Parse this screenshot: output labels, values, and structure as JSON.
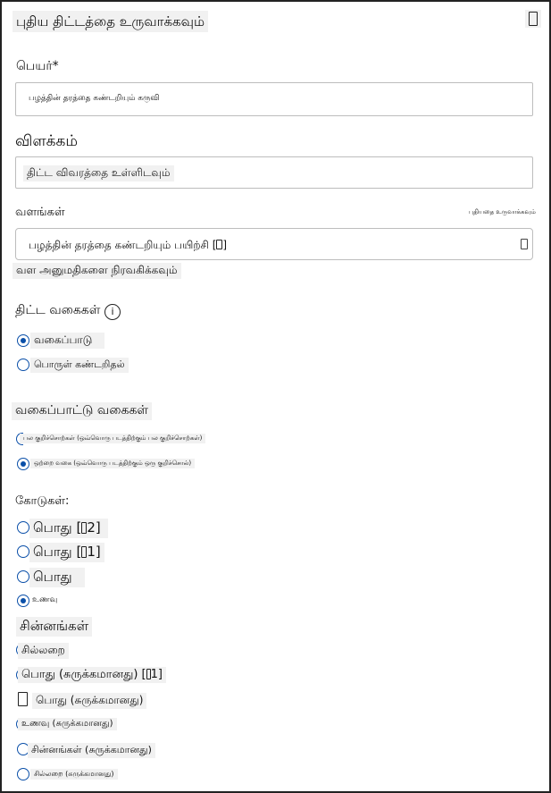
{
  "header": {
    "title": "புதிய திட்டத்தை உருவாக்கவும்",
    "close_glyph": ""
  },
  "name_field": {
    "label": "பெயர்*",
    "value": "பழத்தின் தரத்தை கண்டறியும் கருவி"
  },
  "description": {
    "label": "விளக்கம்",
    "placeholder": "திட்ட விவரத்தை உள்ளிடவும்"
  },
  "resources": {
    "label": "வளங்கள்",
    "create_new": "புதியதை உருவாக்கவும்",
    "selected": "பழத்தின் தரத்தை கண்டறியும் பயிற்சி [",
    "selected_suffix": "]",
    "manage": "வள அனுமதிகளை நிரவகிக்கவும்"
  },
  "project_types": {
    "label": "திட்ட வகைகள்",
    "info_icon": "i",
    "options": [
      "வகைப்பாடு",
      "பொருள் கண்டறிதல்"
    ],
    "selected": 0
  },
  "classification_types": {
    "label": "வகைப்பாட்டு வகைகள்",
    "options": [
      "பல குறிச்சொற்கள் (ஒவ்வொரு படத்திற்கும் பல குறிச்சொற்கள்)",
      "ஒற்றை வகை (ஒவ்வொரு படத்திற்கும் ஒரு குறிச்சொல்)"
    ],
    "selected": 1
  },
  "domains": {
    "label": "கோடுகள்:",
    "items": [
      {
        "text": "பொது [",
        "suffix": "2]"
      },
      {
        "text": "பொது [",
        "suffix": "1]"
      },
      {
        "text": "பொது",
        "suffix": ""
      },
      {
        "text": "உணவு",
        "suffix": ""
      },
      {
        "text": "சின்னங்கள்",
        "suffix": ""
      },
      {
        "text": "சில்லறை",
        "suffix": ""
      },
      {
        "text": "பொது (சுருக்கமானது) [",
        "suffix": "1]"
      },
      {
        "text": "பொது (சுருக்கமானது)",
        "suffix": ""
      },
      {
        "text": "உணவு (சுருக்கமானது)",
        "suffix": ""
      },
      {
        "text": "சின்னங்கள் (சுருக்கமானது)",
        "suffix": ""
      },
      {
        "text": "சில்லறை (சுருக்கமானது)",
        "suffix": ""
      }
    ],
    "selected": 3
  }
}
